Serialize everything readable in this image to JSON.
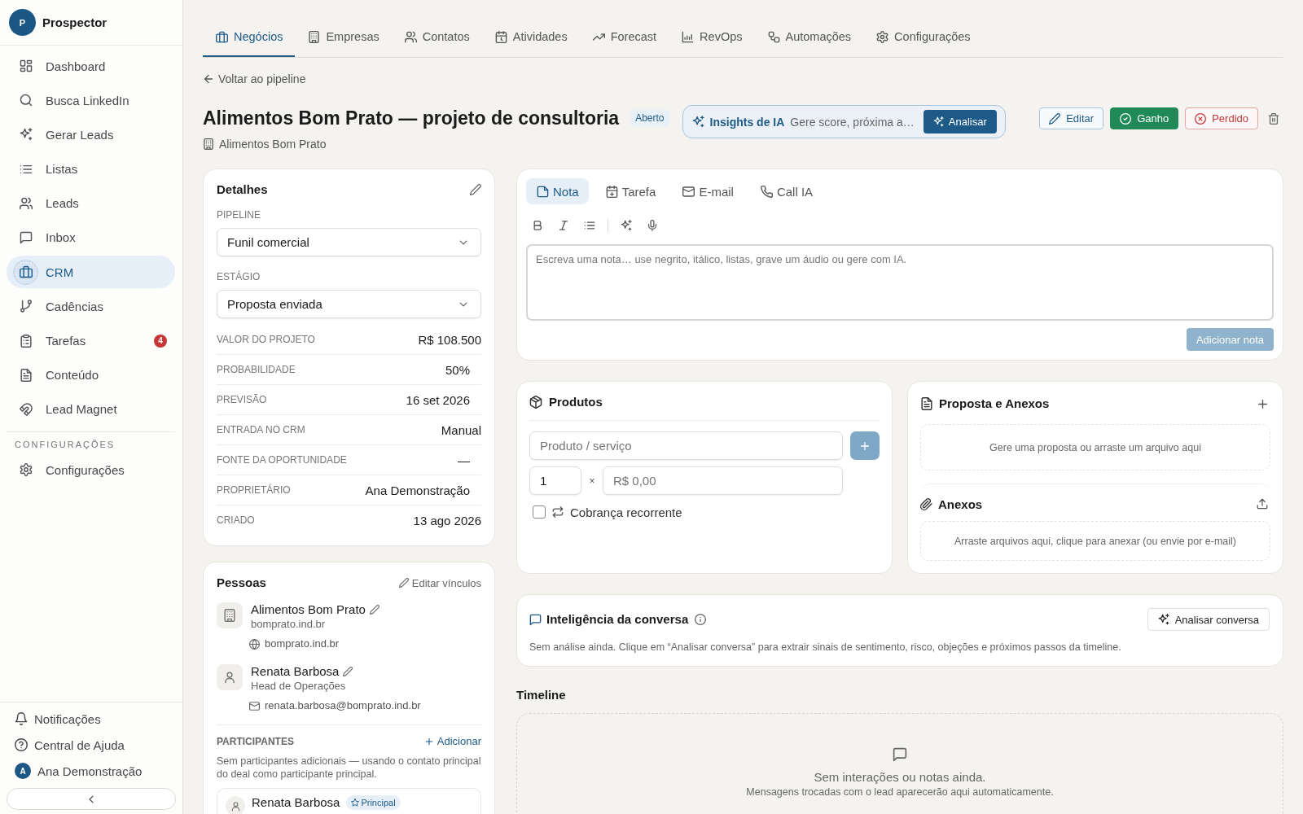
{
  "sidebar": {
    "brand": {
      "initial": "P",
      "name": "Prospector"
    },
    "items": [
      {
        "label": "Dashboard",
        "selected": false
      },
      {
        "label": "Busca LinkedIn",
        "selected": false
      },
      {
        "label": "Gerar Leads",
        "selected": false
      },
      {
        "label": "Listas",
        "selected": false
      },
      {
        "label": "Leads",
        "selected": false
      },
      {
        "label": "Inbox",
        "selected": false
      },
      {
        "label": "CRM",
        "selected": true
      },
      {
        "label": "Cadências",
        "selected": false
      },
      {
        "label": "Tarefas",
        "selected": false,
        "badge": "4"
      },
      {
        "label": "Conteúdo",
        "selected": false
      },
      {
        "label": "Lead Magnet",
        "selected": false
      }
    ],
    "section": {
      "title": "CONFIGURAÇÕES",
      "items": [
        {
          "label": "Configurações",
          "selected": false
        }
      ]
    },
    "footer": {
      "links": [
        {
          "label": "Notificações"
        },
        {
          "label": "Central de Ajuda"
        }
      ],
      "user": {
        "initial": "A",
        "name": "Ana Demonstração"
      }
    }
  },
  "tabs": [
    {
      "label": "Negócios",
      "selected": true
    },
    {
      "label": "Empresas",
      "selected": false
    },
    {
      "label": "Contatos",
      "selected": false
    },
    {
      "label": "Atividades",
      "selected": false
    },
    {
      "label": "Forecast",
      "selected": false
    },
    {
      "label": "RevOps",
      "selected": false
    },
    {
      "label": "Automações",
      "selected": false
    },
    {
      "label": "Configurações",
      "selected": false
    }
  ],
  "back_link": "Voltar ao pipeline",
  "deal": {
    "title": "Alimentos Bom Prato — projeto de consultoria",
    "status": "Aberto",
    "company": "Alimentos Bom Prato"
  },
  "ai_insights": {
    "title": "Insights de IA",
    "hint": "Gere score, próxima a…",
    "button": "Analisar"
  },
  "actions": [
    {
      "kind": "edit",
      "label": "Editar"
    },
    {
      "kind": "won",
      "label": "Ganho"
    },
    {
      "kind": "lost",
      "label": "Perdido"
    },
    {
      "kind": "delete"
    }
  ],
  "details": {
    "title": "Detalhes",
    "selects": [
      {
        "label": "PIPELINE",
        "value": "Funil comercial"
      },
      {
        "label": "ESTÁGIO",
        "value": "Proposta enviada"
      }
    ],
    "rows": [
      {
        "kind": "static",
        "label": "VALOR DO PROJETO",
        "value": "R$ 108.500"
      },
      {
        "kind": "editable",
        "label": "PROBABILIDADE",
        "value": "50%"
      },
      {
        "kind": "editable",
        "label": "PREVISÃO",
        "value": "16 set 2026"
      },
      {
        "kind": "static",
        "label": "ENTRADA NO CRM",
        "value": "Manual"
      },
      {
        "kind": "editable",
        "label": "FONTE DA OPORTUNIDADE",
        "value": "—"
      },
      {
        "kind": "editable",
        "label": "PROPRIETÁRIO",
        "value": "Ana Demonstração"
      },
      {
        "kind": "static",
        "label": "CRIADO",
        "value": "13 ago 2026"
      }
    ]
  },
  "people": {
    "title": "Pessoas",
    "edit_link": "Editar vínculos",
    "entries": [
      {
        "kind": "company",
        "name": "Alimentos Bom Prato",
        "subtitle": "bomprato.ind.br",
        "detail": "bomprato.ind.br"
      },
      {
        "kind": "person",
        "name": "Renata Barbosa",
        "subtitle": "Head de Operações",
        "detail": "renata.barbosa@bomprato.ind.br"
      }
    ],
    "participants": {
      "title": "PARTICIPANTES",
      "add": "Adicionar",
      "note": "Sem participantes adicionais — usando o contato principal do deal como participante principal.",
      "items": [
        {
          "name": "Renata Barbosa",
          "badge": "Principal"
        }
      ]
    }
  },
  "composer": {
    "tabs": [
      {
        "label": "Nota",
        "selected": true
      },
      {
        "label": "Tarefa",
        "selected": false
      },
      {
        "label": "E-mail",
        "selected": false
      },
      {
        "label": "Call IA",
        "selected": false
      }
    ],
    "placeholder": "Escreva uma nota… use negrito, itálico, listas, grave um áudio ou gere com IA.",
    "submit": {
      "label": "Adicionar nota",
      "disabled": true
    }
  },
  "products": {
    "title": "Produtos",
    "product_field": {
      "placeholder": "Produto / serviço"
    },
    "quantity_field": {
      "value": "1"
    },
    "multiply": "×",
    "price_field": {
      "placeholder": "R$ 0,00"
    },
    "recurring": {
      "label": "Cobrança recorrente",
      "checked": false
    }
  },
  "proposal": {
    "title": "Proposta e Anexos",
    "dropzone": "Gere uma proposta ou arraste um arquivo aqui",
    "attachments": {
      "title": "Anexos",
      "dropzone": "Arraste arquivos aqui, clique para anexar (ou envie por e-mail)"
    }
  },
  "conversation": {
    "title": "Inteligência da conversa",
    "button": "Analisar conversa",
    "text": "Sem análise ainda. Clique em “Analisar conversa” para extrair sinais de sentimento, risco, objeções e próximos passos da timeline."
  },
  "timeline": {
    "title": "Timeline",
    "empty_title": "Sem interações ou notas ainda.",
    "empty_text": "Mensagens trocadas com o lead aparecerão aqui automaticamente."
  }
}
